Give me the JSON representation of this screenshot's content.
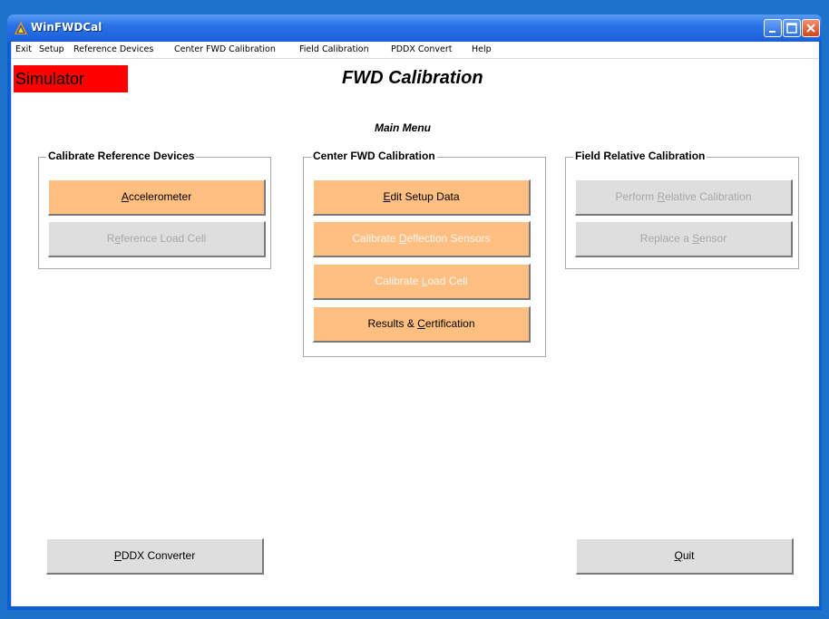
{
  "window": {
    "title": "WinFWDCal"
  },
  "menu": [
    "Exit",
    "Setup",
    "Reference Devices",
    "Center FWD Calibration",
    "Field Calibration",
    "PDDX Convert",
    "Help"
  ],
  "simulator_label": "Simulator",
  "app_title": "FWD Calibration",
  "subtitle": "Main Menu",
  "groups": {
    "reference": {
      "label": "Calibrate Reference Devices",
      "accelerometer": {
        "pre": "",
        "ul": "A",
        "post": "ccelerometer"
      },
      "load_cell": {
        "pre": "R",
        "ul": "e",
        "post": "ference Load Cell"
      }
    },
    "center": {
      "label": "Center FWD Calibration",
      "edit_setup": {
        "pre": "",
        "ul": "E",
        "post": "dit Setup Data"
      },
      "deflection": {
        "pre": "Calibrate ",
        "ul": "D",
        "post": "eflection Sensors"
      },
      "load_cell": {
        "pre": "Calibrate ",
        "ul": "L",
        "post": "oad Cell"
      },
      "results": {
        "pre": "Results & ",
        "ul": "C",
        "post": "ertification"
      }
    },
    "field": {
      "label": "Field Relative Calibration",
      "relative": {
        "pre": "Perform ",
        "ul": "R",
        "post": "elative Calibration"
      },
      "replace": {
        "pre": "Replace a ",
        "ul": "S",
        "post": "ensor"
      }
    }
  },
  "pddx_button": {
    "pre": "",
    "ul": "P",
    "post": "DDX Converter"
  },
  "quit_button": {
    "pre": "",
    "ul": "Q",
    "post": "uit"
  },
  "colors": {
    "active_button": "#ffbf80",
    "neutral_button": "#dedede",
    "simulator_bg": "#ff0000",
    "titlebar": "#2b73e6"
  }
}
